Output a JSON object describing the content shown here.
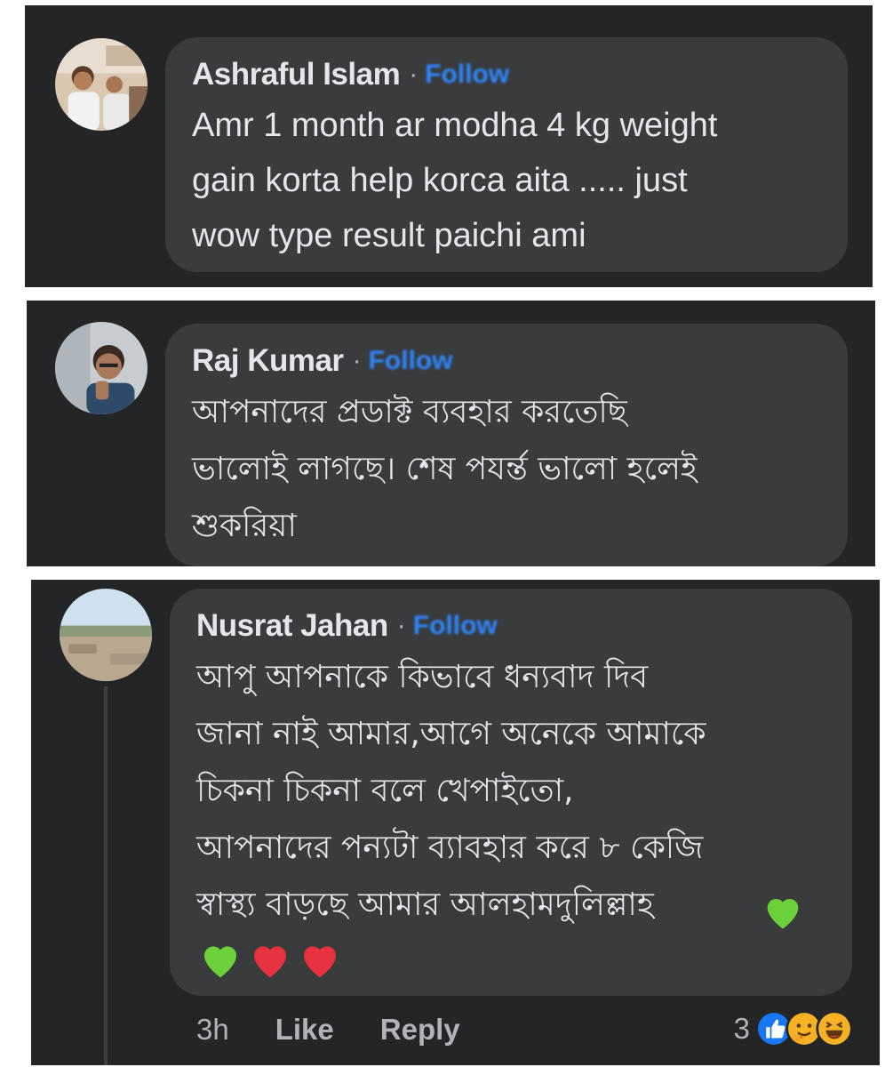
{
  "comments": [
    {
      "author": "Ashraful Islam",
      "follow_label": "Follow",
      "separator": "·",
      "lines": [
        "Amr 1 month ar modha 4 kg weight",
        "gain korta help korca aita ..... just",
        "wow type result paichi ami"
      ]
    },
    {
      "author": "Raj Kumar",
      "follow_label": "Follow",
      "separator": "·",
      "lines": [
        "আপনাদের প্রডাক্ট ব্যবহার করতেছি",
        "ভালোই লাগছে। শেষ পযর্ন্ত ভালো হলেই",
        "শুকরিয়া"
      ]
    },
    {
      "author": "Nusrat Jahan",
      "follow_label": "Follow",
      "separator": "·",
      "lines": [
        "আপু আপনাকে কিভাবে ধন্যবাদ দিব",
        "জানা নাই আমার,আগে অনেকে আমাকে",
        "চিকনা চিকনা বলে খেপাইতো,",
        "আপনাদের পন্যটা ব্যাবহার করে ৮ কেজি",
        "স্বাস্থ্য বাড়ছে আমার আলহামদুলিল্লাহ"
      ],
      "emojis": [
        "green-heart",
        "green-heart",
        "red-heart",
        "red-heart"
      ],
      "timestamp": "3h",
      "like_label": "Like",
      "reply_label": "Reply",
      "reaction_count": "3",
      "reaction_types": [
        "like",
        "hug",
        "haha"
      ]
    }
  ],
  "colors": {
    "panel_bg": "#242526",
    "bubble_bg": "#3a3b3c",
    "text_primary": "#e4e6eb",
    "text_secondary": "#b0b3b8",
    "follow_blue": "#2d88ff",
    "green_heart": "#6bd13a",
    "red_heart": "#e8323f"
  }
}
